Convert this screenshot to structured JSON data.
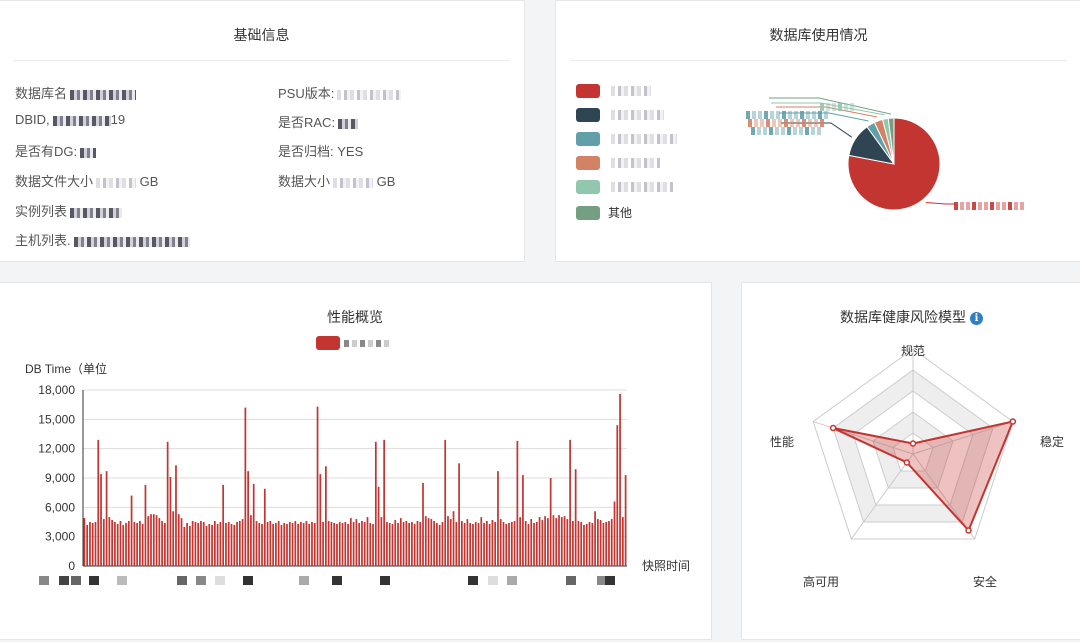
{
  "basic_info": {
    "title": "基础信息",
    "fields": [
      {
        "label": "数据库名",
        "value": ""
      },
      {
        "label": "PSU版本:",
        "value": ""
      },
      {
        "label": "DBID,",
        "value": "19"
      },
      {
        "label": "是否RAC:",
        "value": ""
      },
      {
        "label": "是否有DG:",
        "value": ""
      },
      {
        "label": "是否归档:",
        "value": "YES"
      },
      {
        "label": "数据文件大小",
        "value": "GB"
      },
      {
        "label": "数据大小",
        "value": "GB"
      },
      {
        "label": "实例列表",
        "value": ""
      },
      {
        "label": "主机列表.",
        "value": ""
      }
    ]
  },
  "db_usage": {
    "title": "数据库使用情况",
    "legend": [
      {
        "label": "",
        "color": "#c23531"
      },
      {
        "label": "",
        "color": "#2f4554"
      },
      {
        "label": "",
        "color": "#61a0a8"
      },
      {
        "label": "",
        "color": "#d48265"
      },
      {
        "label": "",
        "color": "#91c7ae"
      },
      {
        "label": "其他",
        "color": "#749f83"
      }
    ]
  },
  "performance": {
    "title": "性能概览",
    "legend_color": "#c23531"
  },
  "risk_model": {
    "title": "数据库健康风险模型",
    "info_icon": "info-icon",
    "axes": [
      "规范",
      "稳定",
      "安全",
      "高可用",
      "性能"
    ],
    "values": [
      0.1,
      1.0,
      0.9,
      0.1,
      0.8
    ],
    "color": "#c23531"
  },
  "chart_data": [
    {
      "type": "bar",
      "ylabel": "DB Time（单位",
      "xlabel": "快照时间",
      "ylim": [
        0,
        18000
      ],
      "y_ticks": [
        "0",
        "3,000",
        "6,000",
        "9,000",
        "12,000",
        "15,000",
        "18,000"
      ],
      "values": [
        4900,
        4200,
        4500,
        4400,
        4500,
        12900,
        9400,
        4800,
        9700,
        5000,
        4700,
        4500,
        4300,
        4600,
        4200,
        4400,
        4600,
        7200,
        4500,
        4400,
        4600,
        4300,
        8300,
        5100,
        5300,
        5300,
        5200,
        4900,
        4600,
        4400,
        12700,
        9100,
        5600,
        10300,
        5300,
        4900,
        4000,
        4400,
        4100,
        4600,
        4500,
        4400,
        4600,
        4500,
        4100,
        4300,
        4200,
        4600,
        4300,
        4500,
        8300,
        4400,
        4500,
        4300,
        4200,
        4500,
        4600,
        4800,
        16200,
        9700,
        5200,
        8400,
        4600,
        4400,
        4300,
        7900,
        4500,
        4600,
        4300,
        4400,
        4600,
        4200,
        4400,
        4300,
        4500,
        4400,
        4600,
        4300,
        4500,
        4400,
        4600,
        4300,
        4500,
        4400,
        16300,
        9400,
        4500,
        10200,
        4600,
        4500,
        4400,
        4300,
        4500,
        4400,
        4500,
        4300,
        4900,
        4500,
        4800,
        4400,
        4600,
        4500,
        5000,
        4400,
        4300,
        12700,
        8100,
        5000,
        12900,
        4500,
        4400,
        4300,
        4700,
        4400,
        4900,
        4500,
        4600,
        4400,
        4500,
        4300,
        4600,
        4500,
        8500,
        5100,
        4900,
        4800,
        4600,
        4400,
        4200,
        4500,
        12900,
        5100,
        4800,
        5600,
        4500,
        10500,
        4600,
        4400,
        4800,
        4400,
        4300,
        4500,
        4400,
        5000,
        4400,
        4600,
        4300,
        4700,
        4500,
        9700,
        4800,
        4500,
        4300,
        4400,
        4500,
        4600,
        12800,
        5000,
        9300,
        4600,
        4300,
        4800,
        4400,
        4500,
        5000,
        4700,
        5100,
        4900,
        9000,
        5200,
        4900,
        5200,
        5000,
        5100,
        4800,
        12900,
        4600,
        9900,
        4600,
        4500,
        4200,
        4300,
        4500,
        4400,
        5600,
        4800,
        4700,
        4400,
        4500,
        4600,
        4800,
        6600,
        14400,
        17600,
        5000,
        9300
      ]
    },
    {
      "type": "pie",
      "values": [
        78,
        12,
        3,
        3,
        2,
        2
      ]
    },
    {
      "type": "radar",
      "axes": [
        "规范",
        "稳定",
        "安全",
        "高可用",
        "性能"
      ],
      "values": [
        0.1,
        1.0,
        0.9,
        0.1,
        0.8
      ]
    }
  ]
}
